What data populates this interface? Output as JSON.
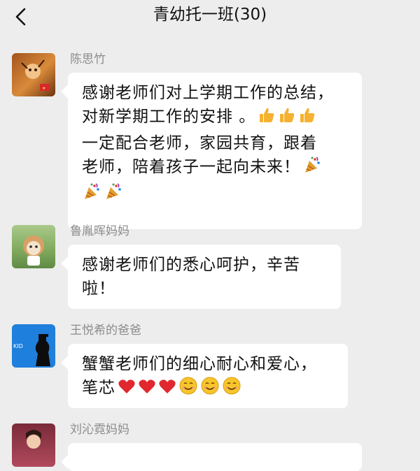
{
  "header": {
    "title": "青幼托一班(30)"
  },
  "messages": [
    {
      "sender": "陈思竹",
      "lines": [
        "感谢老师们对上学期工作的总结，",
        "对新学期工作的安排 。",
        "一定配合老师，家园共育，跟着",
        "老师，陪着孩子一起向未来！"
      ],
      "emoji": [
        "thumbs-up",
        "thumbs-up",
        "thumbs-up",
        "party-popper",
        "party-popper",
        "party-popper"
      ]
    },
    {
      "sender": "鲁胤晖妈妈",
      "lines": [
        "感谢老师们的悉心呵护，辛苦",
        "啦！"
      ],
      "emoji": []
    },
    {
      "sender": "王悦希的爸爸",
      "lines": [
        "蟹蟹老师们的细心耐心和爱心，",
        "笔芯"
      ],
      "emoji": [
        "red-heart",
        "red-heart",
        "red-heart",
        "smiling-face",
        "smiling-face",
        "smiling-face"
      ],
      "avatar_text": "KID"
    },
    {
      "sender": "刘沁霓妈妈",
      "lines": [],
      "emoji": []
    }
  ],
  "colors": {
    "background": "#ededed",
    "bubble": "#ffffff",
    "sender_name": "#8c8c8c",
    "thumb": "#f5b12f",
    "heart": "#e0282e",
    "smile": "#f7c52c"
  }
}
